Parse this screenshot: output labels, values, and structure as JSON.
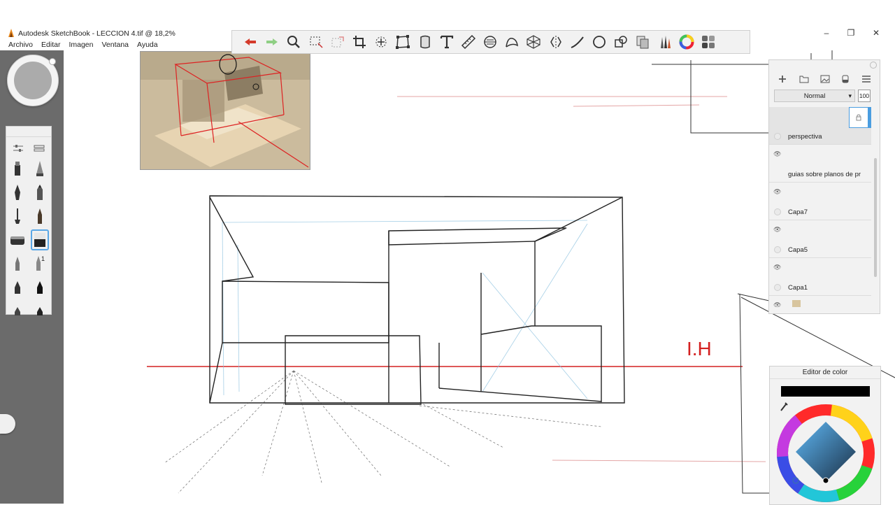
{
  "window": {
    "title": "Autodesk SketchBook - LECCION 4.tif @ 18,2%",
    "controls": {
      "minimize": "–",
      "maximize": "❐",
      "close": "✕"
    }
  },
  "menu": {
    "items": [
      "Archivo",
      "Editar",
      "Imagen",
      "Ventana",
      "Ayuda"
    ]
  },
  "toolbar": {
    "tools": [
      "undo-icon",
      "redo-icon",
      "zoom-icon",
      "select-icon",
      "transform-select-icon",
      "crop-icon",
      "move-icon",
      "distort-icon",
      "fill-icon",
      "text-icon",
      "ruler-icon",
      "ellipse-guide-icon",
      "french-curve-icon",
      "perspective-icon",
      "symmetry-icon",
      "stroke-icon",
      "circle-icon",
      "shapes-icon",
      "copy-icon",
      "brushes-icon",
      "color-wheel-icon",
      "palette-icon"
    ]
  },
  "brush_palette": {
    "badge": "1"
  },
  "layers": {
    "blend_mode": "Normal",
    "opacity": "100",
    "items": [
      {
        "name": "perspectiva",
        "selected": true
      },
      {
        "name": "guias sobre planos de pr...",
        "selected": false
      },
      {
        "name": "Capa7",
        "selected": false
      },
      {
        "name": "Capa5",
        "selected": false
      },
      {
        "name": "Capa1",
        "selected": false
      },
      {
        "name": "",
        "selected": false
      }
    ]
  },
  "color_editor": {
    "title": "Editor de color",
    "current_color": "#000000"
  },
  "canvas": {
    "annotation": "I.H",
    "accent_red": "#d42020"
  }
}
